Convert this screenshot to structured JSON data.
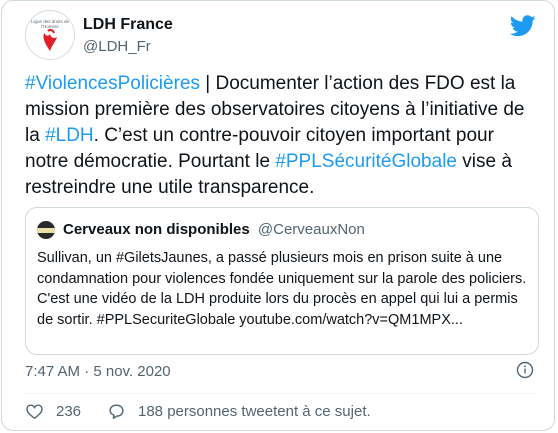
{
  "author": {
    "name": "LDH France",
    "handle": "@LDH_Fr",
    "avatar_text": "Ligue des droits de l'Homme",
    "avatar_icon": "ldh-logo-icon"
  },
  "tweet": {
    "part1_link": "#ViolencesPolicières",
    "part2": " | Documenter l’action des FDO est la mission première des observatoires citoyens à l’initiative de la ",
    "part3_link": "#LDH",
    "part4": ". C’est un contre-pouvoir citoyen important pour notre démocratie. Pourtant le ",
    "part5_link": "#PPLSécuritéGlobale",
    "part6": " vise à restreindre une utile transparence."
  },
  "quote": {
    "name": "Cerveaux non disponibles",
    "handle": "@CerveauxNon",
    "text": "Sullivan, un #GiletsJaunes, a passé plusieurs mois en prison suite à une condamnation pour violences fondée uniquement sur la parole des policiers. C'est une vidéo de la LDH produite lors du procès en appel qui lui a permis de sortir. #PPLSecuriteGlobale youtube.com/watch?v=QM1MPX..."
  },
  "timestamp": "7:47 AM · 5 nov. 2020",
  "actions": {
    "likes": "236",
    "replies_text": "188 personnes tweetent à ce sujet."
  },
  "colors": {
    "link": "#1d9bf0",
    "muted": "#536471",
    "border": "#cfd9de",
    "brand_red": "#e2202c"
  }
}
